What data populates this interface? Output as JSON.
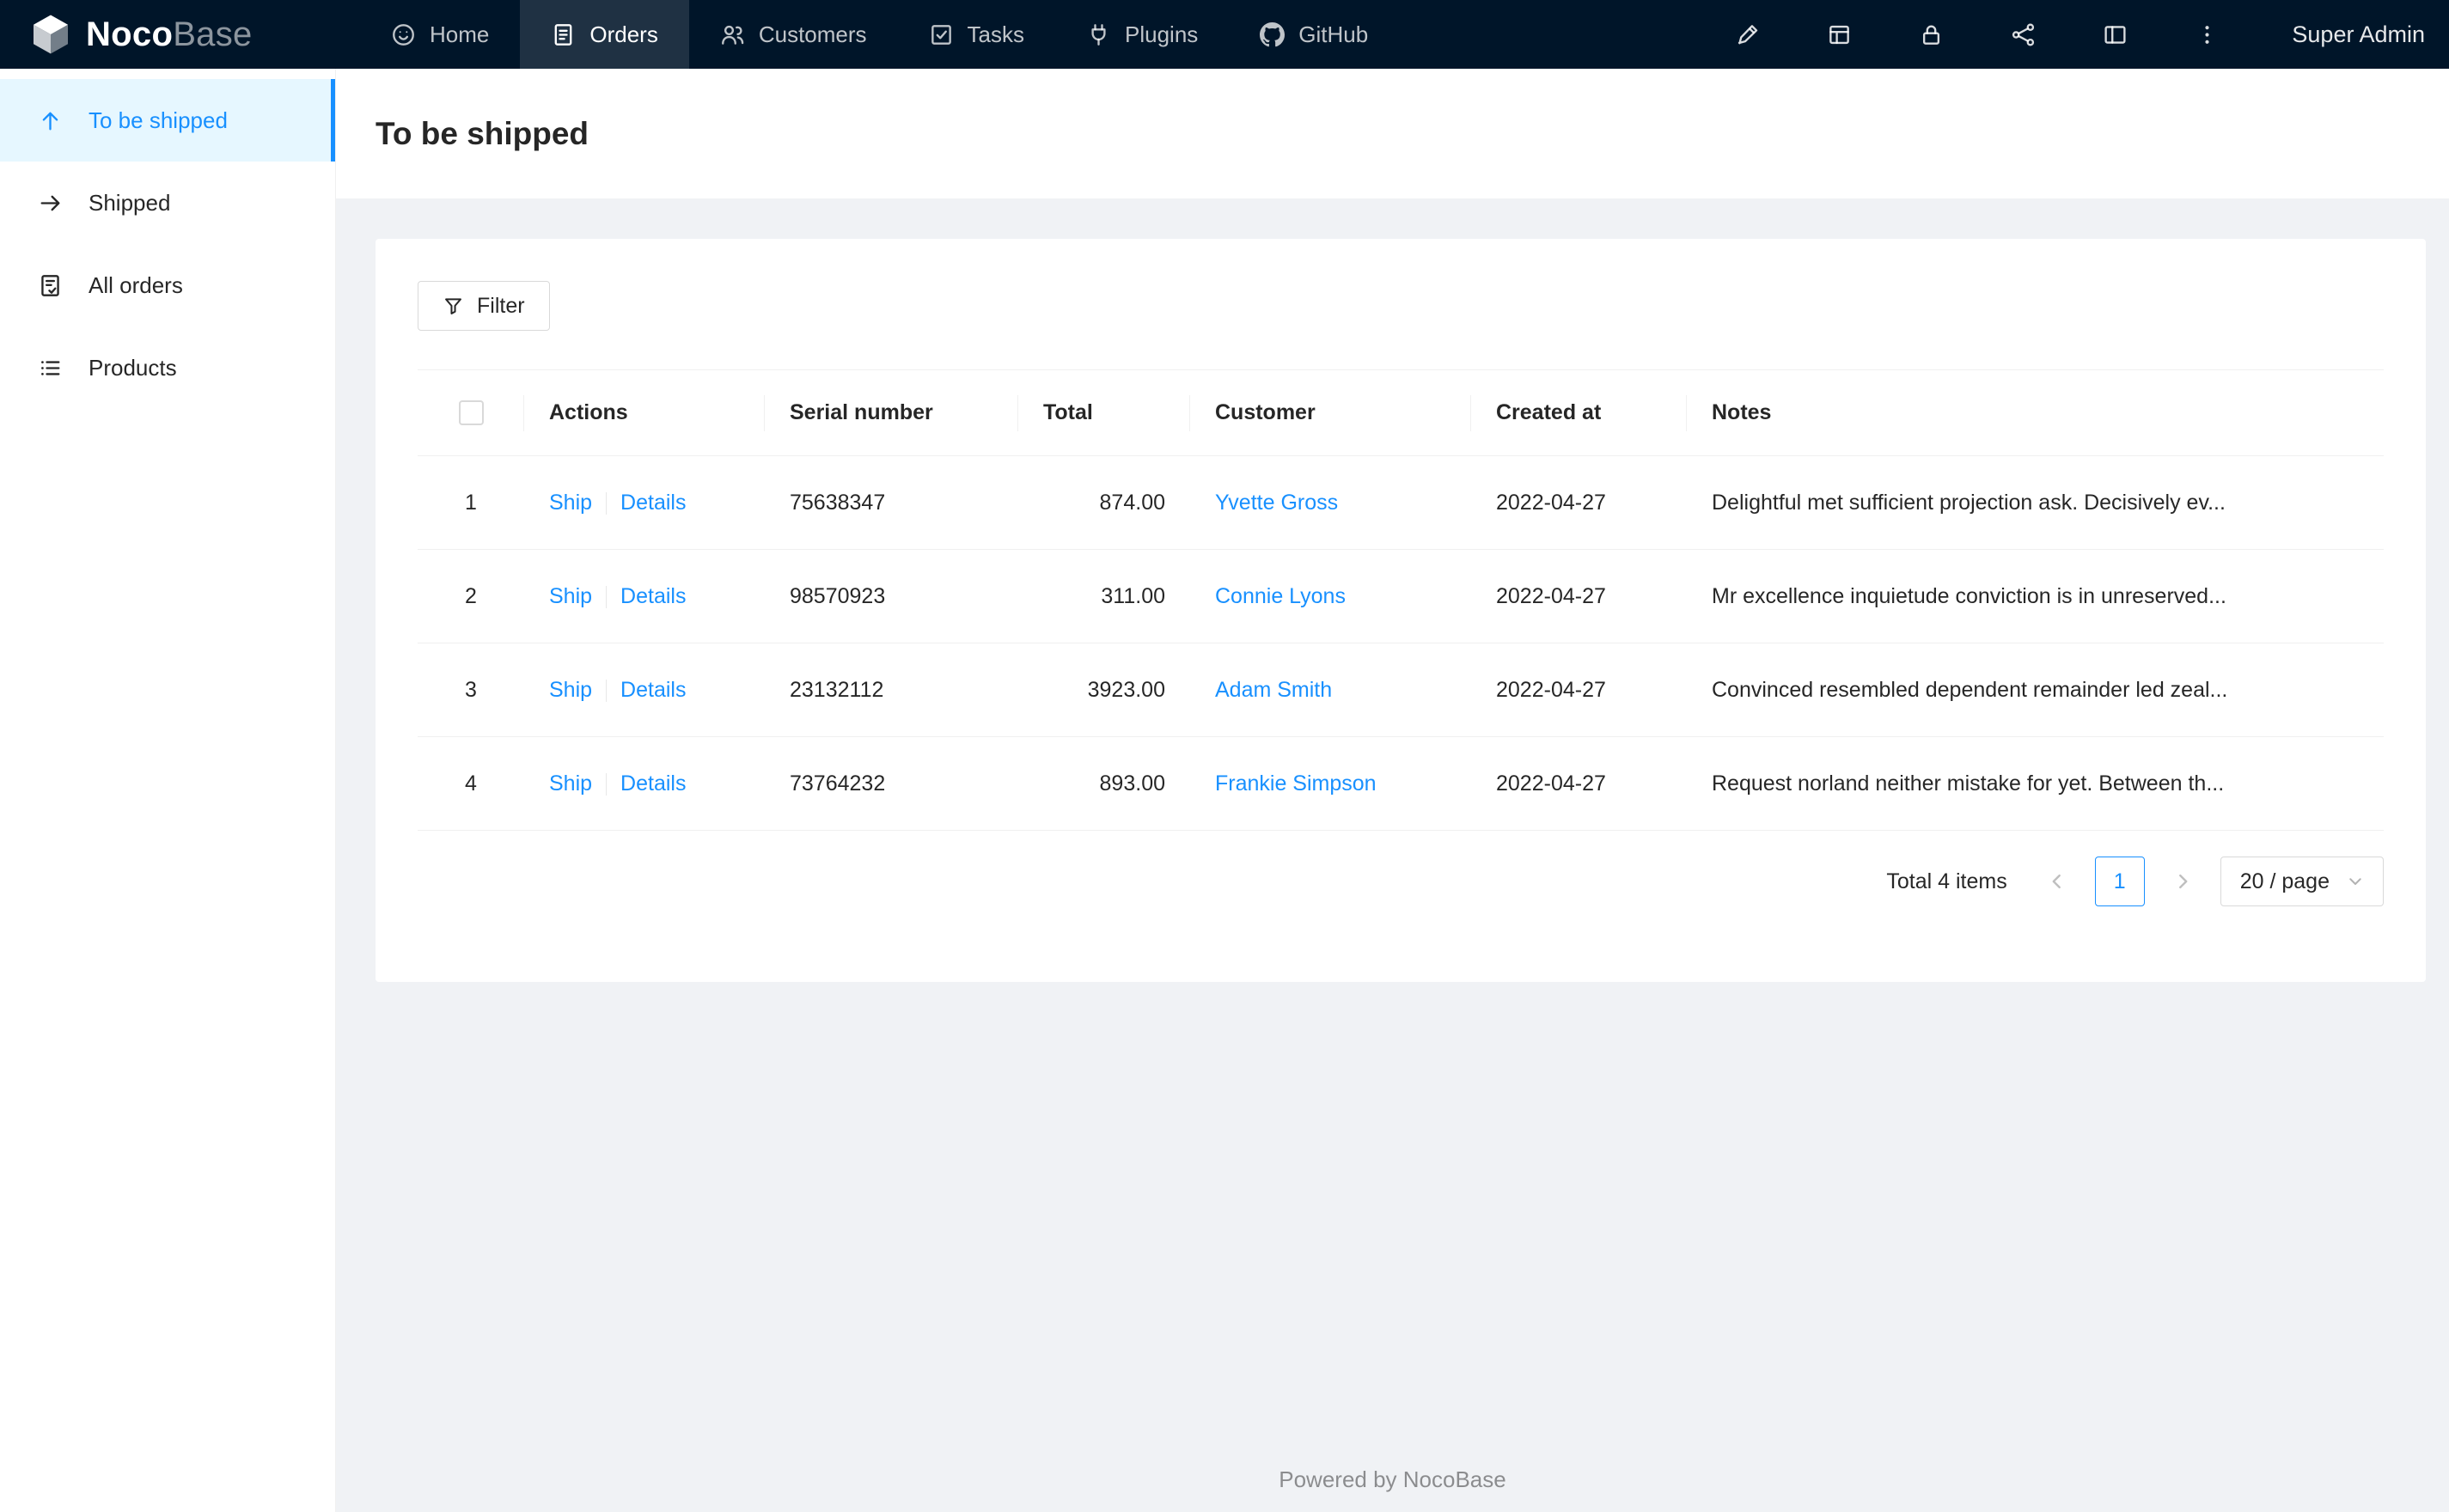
{
  "colors": {
    "accent": "#1890ff",
    "nav_bg": "#001529",
    "sidebar_active_bg": "#e6f7ff",
    "link": "#1890ff",
    "content_bg": "#f0f2f5"
  },
  "topnav": {
    "brand": {
      "primary": "Noco",
      "secondary": "Base"
    },
    "items": [
      {
        "label": "Home"
      },
      {
        "label": "Orders",
        "active": true
      },
      {
        "label": "Customers"
      },
      {
        "label": "Tasks"
      },
      {
        "label": "Plugins"
      },
      {
        "label": "GitHub"
      }
    ],
    "right_icons": [
      "ui-editor-highlighter",
      "collections-table",
      "lock",
      "api-share",
      "layout",
      "more-vertical"
    ],
    "user": "Super Admin"
  },
  "sidebar": {
    "items": [
      {
        "label": "To be shipped",
        "icon": "arrow-up",
        "active": true
      },
      {
        "label": "Shipped",
        "icon": "arrow-right"
      },
      {
        "label": "All orders",
        "icon": "file-check"
      },
      {
        "label": "Products",
        "icon": "list"
      }
    ]
  },
  "page": {
    "title": "To be shipped"
  },
  "toolbar": {
    "filter_label": "Filter",
    "filter_icon": "funnel"
  },
  "table": {
    "columns": {
      "actions": "Actions",
      "serial": "Serial number",
      "total": "Total",
      "customer": "Customer",
      "created": "Created at",
      "notes": "Notes"
    },
    "rows": [
      {
        "index": "1",
        "ship": "Ship",
        "details": "Details",
        "serial": "75638347",
        "total": "874.00",
        "customer": "Yvette Gross",
        "created": "2022-04-27",
        "notes": "Delightful met sufficient projection ask. Decisively ev..."
      },
      {
        "index": "2",
        "ship": "Ship",
        "details": "Details",
        "serial": "98570923",
        "total": "311.00",
        "customer": "Connie Lyons",
        "created": "2022-04-27",
        "notes": "Mr excellence inquietude conviction is in unreserved..."
      },
      {
        "index": "3",
        "ship": "Ship",
        "details": "Details",
        "serial": "23132112",
        "total": "3923.00",
        "customer": "Adam Smith",
        "created": "2022-04-27",
        "notes": "Convinced resembled dependent remainder led zeal..."
      },
      {
        "index": "4",
        "ship": "Ship",
        "details": "Details",
        "serial": "73764232",
        "total": "893.00",
        "customer": "Frankie Simpson",
        "created": "2022-04-27",
        "notes": "Request norland neither mistake for yet. Between th..."
      }
    ]
  },
  "pagination": {
    "total_text": "Total 4 items",
    "current_page": "1",
    "page_size": "20 / page",
    "prev_icon": "chevron-left",
    "next_icon": "chevron-right"
  },
  "footer": {
    "text": "Powered by NocoBase"
  }
}
